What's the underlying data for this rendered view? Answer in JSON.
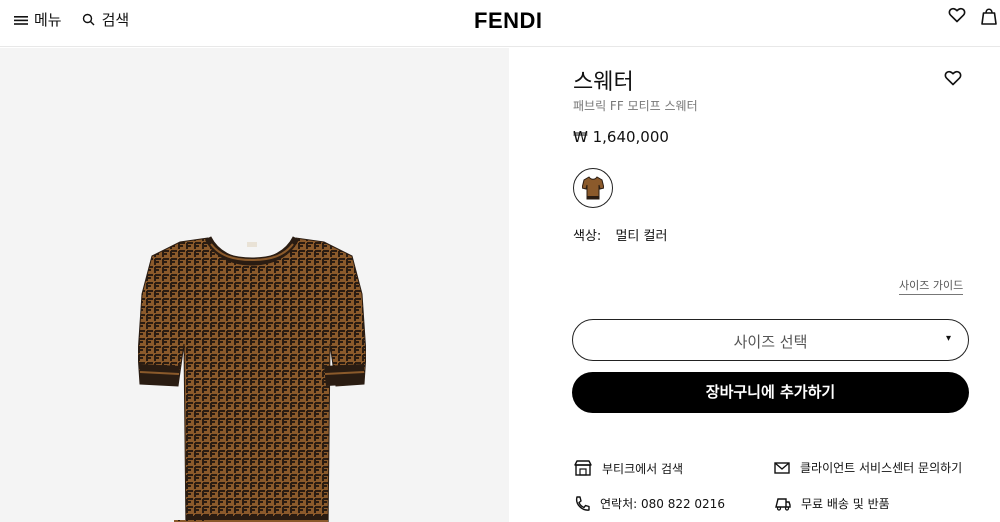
{
  "header": {
    "menu_label": "메뉴",
    "search_label": "검색",
    "logo": "FENDI"
  },
  "product": {
    "title": "스웨터",
    "subtitle": "패브릭 FF 모티프 스웨터",
    "price": "₩ 1,640,000",
    "color_label": "색상:",
    "color_value": "멀티 컬러",
    "size_guide": "사이즈 가이드",
    "size_select_placeholder": "사이즈 선택",
    "add_to_cart": "장바구니에 추가하기"
  },
  "services": [
    {
      "label": "부티크에서 검색",
      "icon": "store-icon"
    },
    {
      "label": "클라이언트 서비스센터 문의하기",
      "icon": "mail-icon"
    },
    {
      "label": "연락처: 080 822 0216",
      "icon": "phone-icon"
    },
    {
      "label": "무료 배송 및 반품",
      "icon": "delivery-truck-icon"
    }
  ],
  "colors": {
    "sweater_brown": "#8b5a2b",
    "sweater_dark": "#2a1c12",
    "button_bg": "#000000",
    "panel_bg": "#f4f4f4"
  }
}
